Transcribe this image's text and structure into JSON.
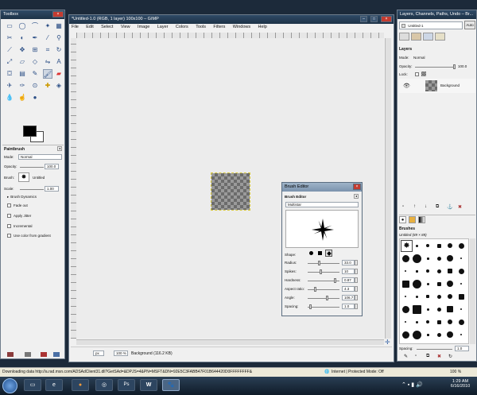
{
  "toolbox": {
    "title": "Toolbox",
    "options_title": "Paintbrush",
    "mode_label": "Mode:",
    "mode_value": "Normal",
    "opacity_label": "Opacity:",
    "opacity_value": "100.0",
    "brush_label": "Brush:",
    "brush_value": "Untitled",
    "scale_label": "Scale:",
    "scale_value": "1.00",
    "options": [
      "Brush Dynamics",
      "Fade out",
      "Apply Jitter",
      "Incremental",
      "Use color from gradient"
    ]
  },
  "image_window": {
    "title": "*Untitled-1.0 (RGB, 1 layer) 100x100 – GIMP",
    "menu": [
      "File",
      "Edit",
      "Select",
      "View",
      "Image",
      "Layer",
      "Colors",
      "Tools",
      "Filters",
      "Windows",
      "Help"
    ],
    "unit": "px",
    "zoom": "100 %",
    "status": "Background (116.2 KB)"
  },
  "brush_editor": {
    "title": "Brush Editor",
    "header": "Brush Editor",
    "name_value": "Multistar",
    "shape_label": "Shape:",
    "params": [
      {
        "label": "Radius:",
        "value": "33.0",
        "level": 0.33
      },
      {
        "label": "Spikes:",
        "value": "10",
        "level": 0.4
      },
      {
        "label": "Hardness:",
        "value": "0.87",
        "level": 0.87
      },
      {
        "label": "Aspect ratio:",
        "value": "4.3",
        "level": 0.2
      },
      {
        "label": "Angle:",
        "value": "106.7",
        "level": 0.6
      },
      {
        "label": "Spacing:",
        "value": "1.0",
        "level": 0.05
      }
    ]
  },
  "layers_dock": {
    "title": "Layers, Channels, Paths, Undo – Br...",
    "image_select": "Untitled-1",
    "auto_label": "Auto",
    "section_title": "Layers",
    "mode_label": "Mode:",
    "mode_value": "Normal",
    "opacity_label": "Opacity:",
    "opacity_value": "100.0",
    "lock_label": "Lock:",
    "layer_name": "Background",
    "brushes_title": "Brushes",
    "brushes_subtitle": "Untitled (89 × 89)",
    "spacing_label": "Spacing:",
    "spacing_value": "1.0"
  },
  "browser_status": {
    "text": "Downloading data http://a.rad.msn.com/ADSAdClient31.dll?GetSAd=&DPJS=4&PN=MSFT&DN=92E5C3FABB47F01B644420D0FFFFFFFF&",
    "zone": "Internet | Protected Mode: Off",
    "zoom": "100 %"
  },
  "taskbar": {
    "time": "1:29 AM",
    "date": "6/16/2010",
    "apps": [
      "Firefox",
      "Chrome",
      "Ps",
      "W",
      "GIMP"
    ]
  }
}
